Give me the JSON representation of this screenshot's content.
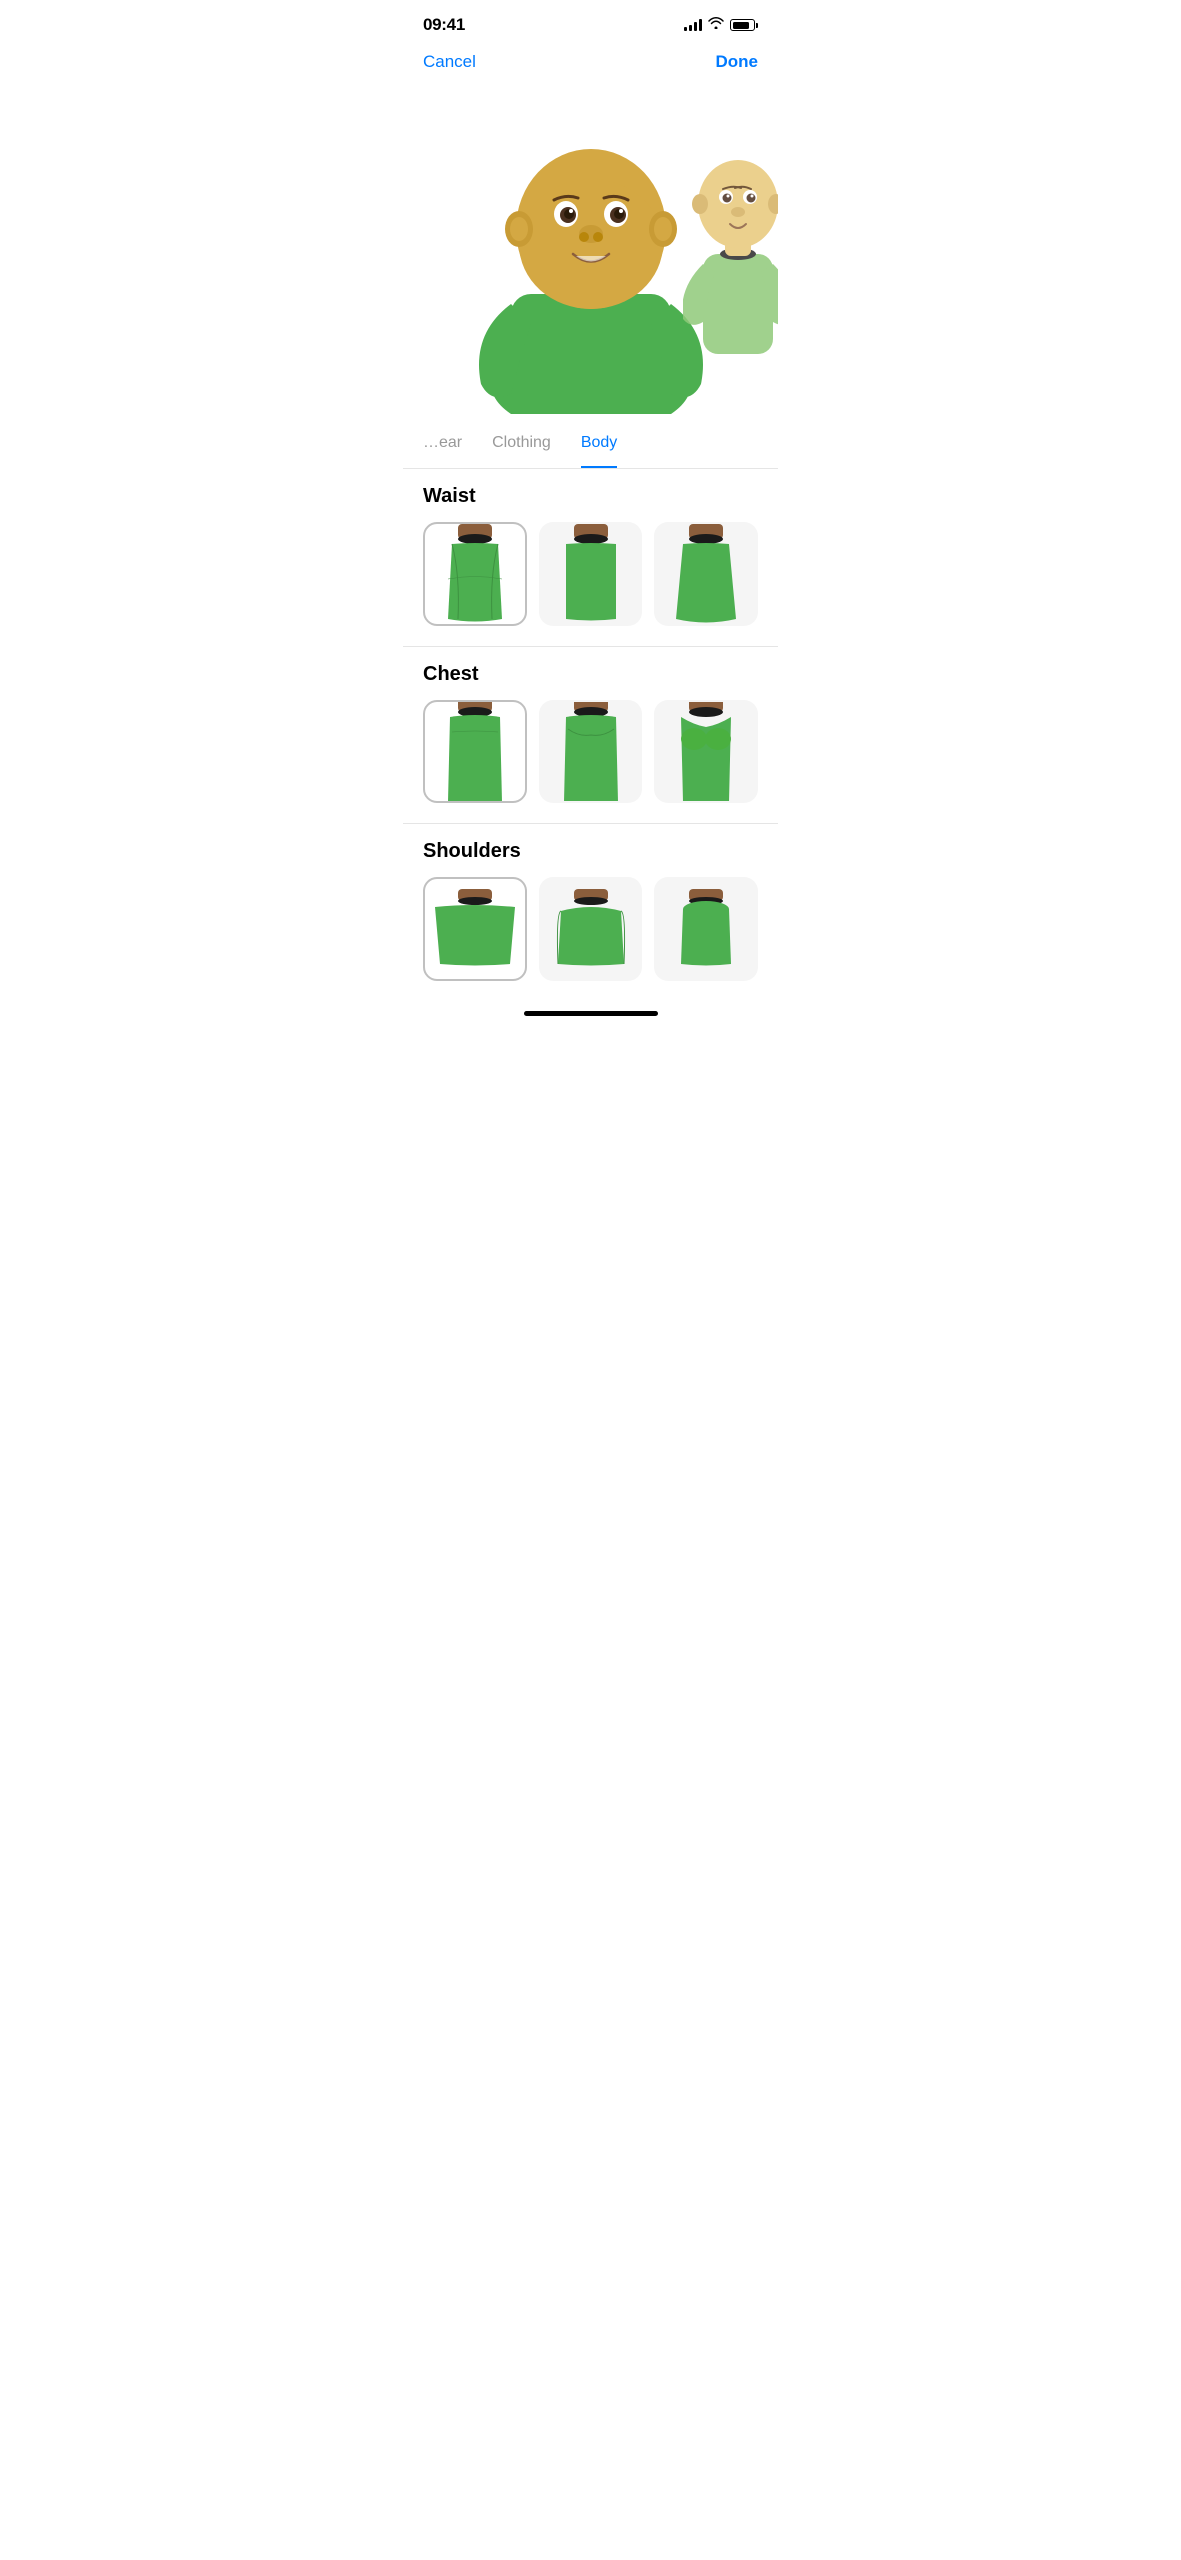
{
  "status_bar": {
    "time": "09:41",
    "signal_bars": [
      4,
      6,
      8,
      10,
      12
    ],
    "wifi": true,
    "battery_percent": 80
  },
  "nav": {
    "cancel_label": "Cancel",
    "done_label": "Done"
  },
  "tabs": [
    {
      "id": "headwear",
      "label": "…ear",
      "active": false
    },
    {
      "id": "clothing",
      "label": "Clothing",
      "active": false
    },
    {
      "id": "body",
      "label": "Body",
      "active": true
    }
  ],
  "sections": [
    {
      "id": "waist",
      "title": "Waist",
      "options": [
        {
          "id": "waist-1",
          "selected": true
        },
        {
          "id": "waist-2",
          "selected": false
        },
        {
          "id": "waist-3",
          "selected": false
        }
      ]
    },
    {
      "id": "chest",
      "title": "Chest",
      "options": [
        {
          "id": "chest-1",
          "selected": true
        },
        {
          "id": "chest-2",
          "selected": false
        },
        {
          "id": "chest-3",
          "selected": false
        }
      ]
    },
    {
      "id": "shoulders",
      "title": "Shoulders",
      "options": [
        {
          "id": "shoulders-1",
          "selected": true
        },
        {
          "id": "shoulders-2",
          "selected": false
        },
        {
          "id": "shoulders-3",
          "selected": false
        }
      ]
    }
  ],
  "colors": {
    "brand_blue": "#007AFF",
    "body_green": "#4CAF50",
    "body_green_dark": "#3d9140",
    "collar_dark": "#1a1a1a",
    "collar_brown": "#8B5E3C",
    "skin_yellow": "#D4A843",
    "skin_dark": "#B8860B",
    "selected_border": "#c0c0c0",
    "background": "#ffffff",
    "section_bg": "#f5f5f5"
  }
}
